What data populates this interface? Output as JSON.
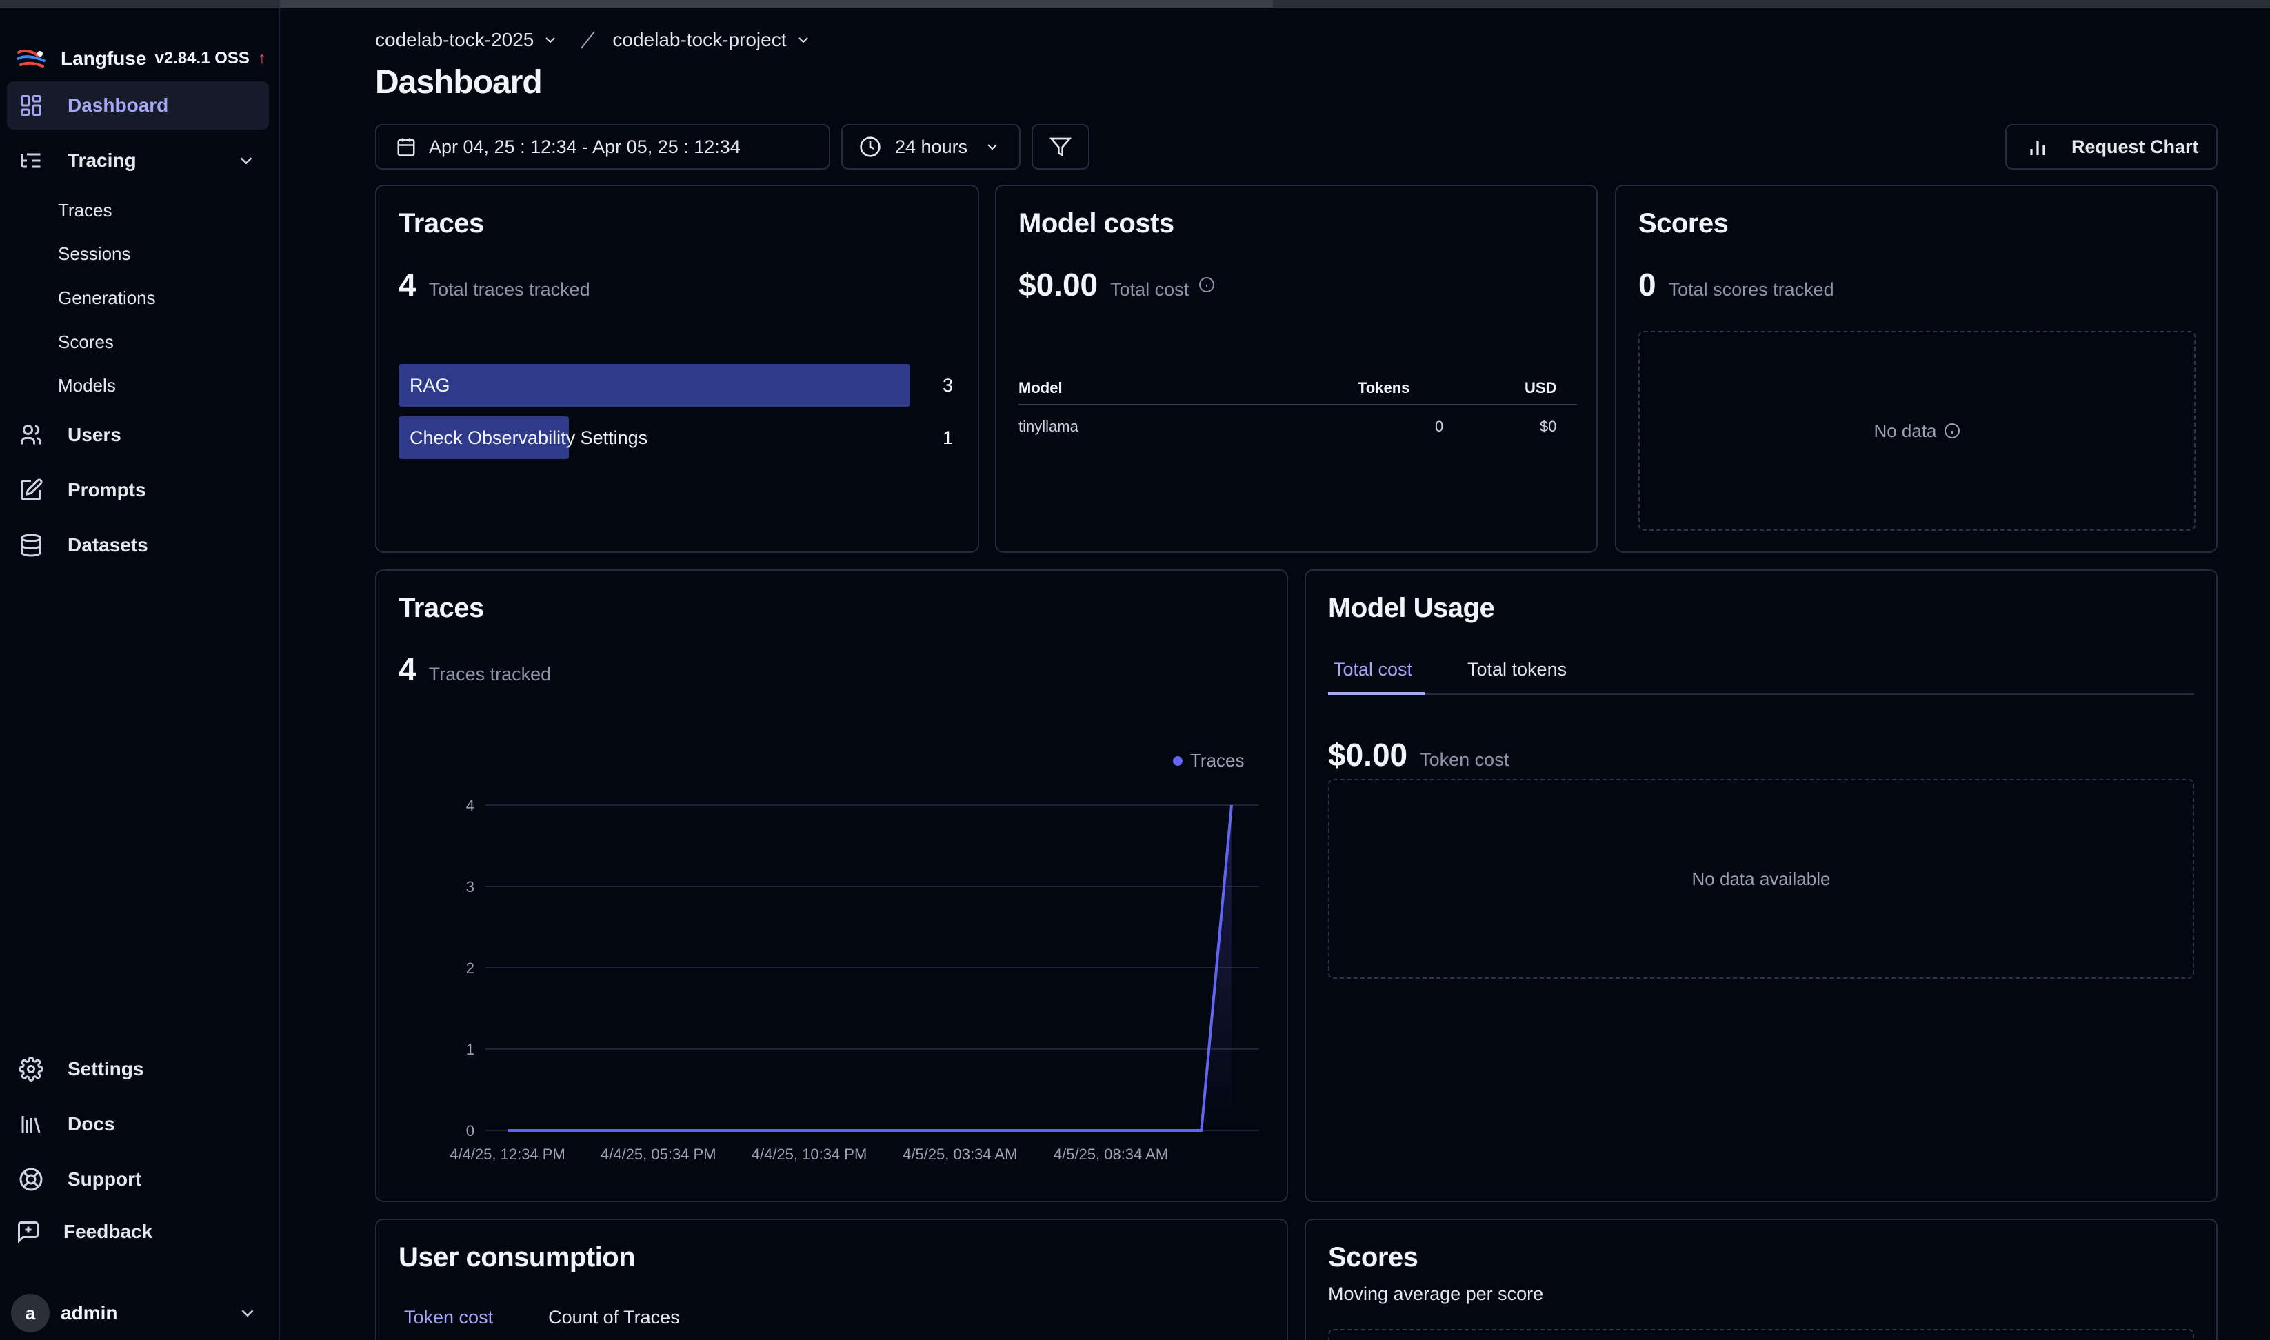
{
  "app": {
    "name": "Langfuse",
    "version": "v2.84.1 OSS"
  },
  "sidebar": {
    "items": [
      {
        "label": "Dashboard",
        "icon": "layout-dashboard-icon",
        "active": true
      },
      {
        "label": "Tracing",
        "icon": "list-tree-icon"
      },
      {
        "label": "Users",
        "icon": "users-icon"
      },
      {
        "label": "Prompts",
        "icon": "file-pen-icon"
      },
      {
        "label": "Datasets",
        "icon": "database-icon"
      }
    ],
    "tracing_sub": [
      "Traces",
      "Sessions",
      "Generations",
      "Scores",
      "Models"
    ],
    "bottom_items": [
      {
        "label": "Settings",
        "icon": "gear-icon"
      },
      {
        "label": "Docs",
        "icon": "library-icon"
      },
      {
        "label": "Support",
        "icon": "life-buoy-icon"
      },
      {
        "label": "Feedback",
        "icon": "message-square-plus-icon"
      }
    ],
    "user": {
      "initial": "a",
      "name": "admin"
    }
  },
  "breadcrumb": {
    "org": "codelab-tock-2025",
    "project": "codelab-tock-project"
  },
  "page": {
    "title": "Dashboard"
  },
  "toolbar": {
    "date_range": "Apr 04, 25 : 12:34 - Apr 05, 25 : 12:34",
    "time_window": "24 hours",
    "request_chart": "Request Chart"
  },
  "traces_card": {
    "title": "Traces",
    "count": "4",
    "count_label": "Total traces tracked",
    "rows": [
      {
        "name": "RAG",
        "value": "3",
        "fraction": 1.0
      },
      {
        "name": "Check Observability Settings",
        "value": "1",
        "fraction": 0.333
      }
    ]
  },
  "costs_card": {
    "title": "Model costs",
    "total": "$0.00",
    "total_label": "Total cost",
    "columns": [
      "Model",
      "Tokens",
      "USD"
    ],
    "rows": [
      {
        "model": "tinyllama",
        "tokens": "0",
        "usd": "$0"
      }
    ]
  },
  "scores_card": {
    "title": "Scores",
    "count": "0",
    "count_label": "Total scores tracked",
    "empty": "No data"
  },
  "traces_chart_card": {
    "title": "Traces",
    "count": "4",
    "count_label": "Traces tracked"
  },
  "usage_card": {
    "title": "Model Usage",
    "tabs": [
      "Total cost",
      "Total tokens"
    ],
    "value": "$0.00",
    "value_label": "Token cost",
    "empty": "No data available"
  },
  "consumption_card": {
    "title": "User consumption",
    "tabs": [
      "Token cost",
      "Count of Traces"
    ]
  },
  "scores_avg_card": {
    "title": "Scores",
    "subtitle": "Moving average per score"
  },
  "colors": {
    "accent": "#6366f1",
    "bar_fill": "#2f3a8a",
    "background": "#030711",
    "update_arrow": "#ef4444"
  },
  "chart_data": {
    "type": "line",
    "x_ticks": [
      "4/4/25, 12:34 PM",
      "4/4/25, 05:34 PM",
      "4/4/25, 10:34 PM",
      "4/5/25, 03:34 AM",
      "4/5/25, 08:34 AM"
    ],
    "y_ticks": [
      "0",
      "1",
      "2",
      "3",
      "4"
    ],
    "ylim": [
      0,
      4
    ],
    "grid": true,
    "legend_position": "top-right",
    "series": [
      {
        "name": "Traces",
        "color": "#6366f1",
        "x_hours": [
          0,
          1,
          2,
          3,
          4,
          5,
          6,
          7,
          8,
          9,
          10,
          11,
          12,
          13,
          14,
          15,
          16,
          17,
          18,
          19,
          20,
          21,
          22,
          23,
          24
        ],
        "values": [
          0,
          0,
          0,
          0,
          0,
          0,
          0,
          0,
          0,
          0,
          0,
          0,
          0,
          0,
          0,
          0,
          0,
          0,
          0,
          0,
          0,
          0,
          0,
          0,
          4
        ]
      }
    ]
  }
}
